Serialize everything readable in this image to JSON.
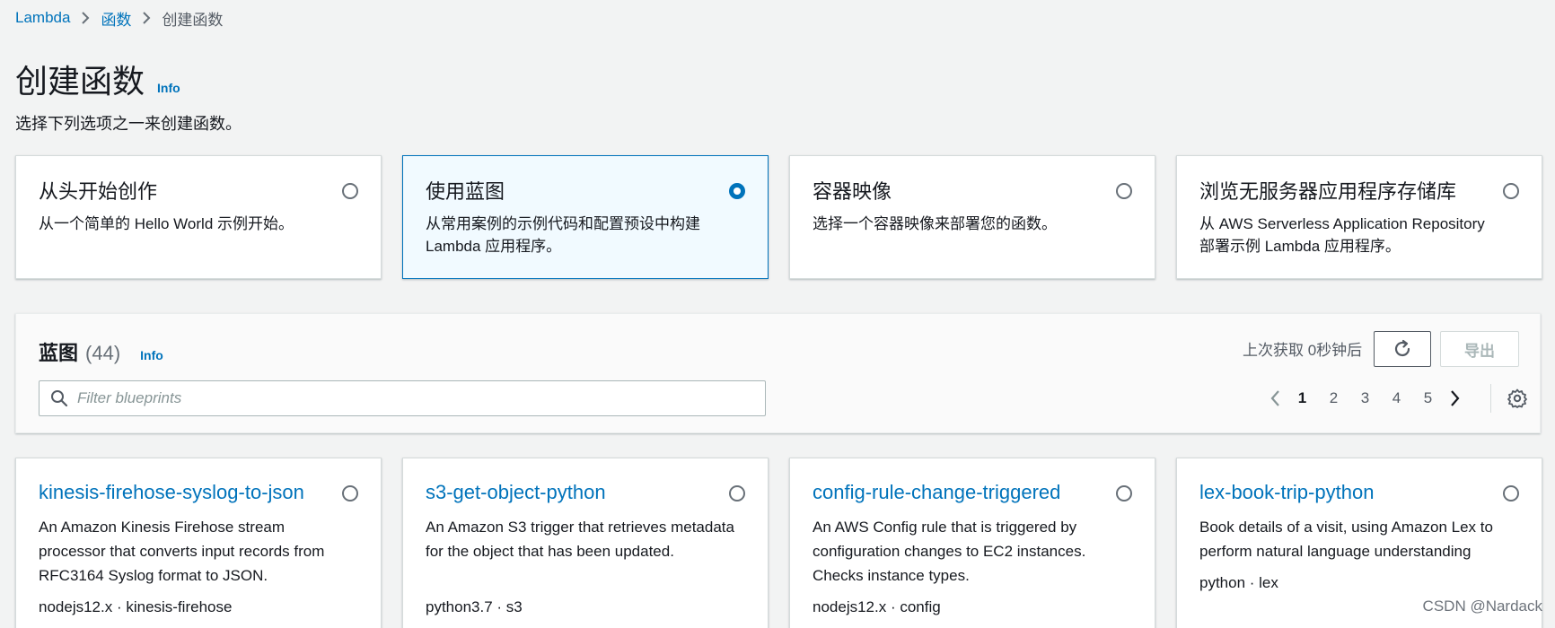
{
  "breadcrumb": {
    "items": [
      "Lambda",
      "函数"
    ],
    "current": "创建函数"
  },
  "header": {
    "title": "创建函数",
    "info": "Info",
    "subtitle": "选择下列选项之一来创建函数。"
  },
  "options": [
    {
      "title": "从头开始创作",
      "description": "从一个简单的 Hello World 示例开始。",
      "selected": false
    },
    {
      "title": "使用蓝图",
      "description": "从常用案例的示例代码和配置预设中构建 Lambda 应用程序。",
      "selected": true
    },
    {
      "title": "容器映像",
      "description": "选择一个容器映像来部署您的函数。",
      "selected": false
    },
    {
      "title": "浏览无服务器应用程序存储库",
      "description": "从 AWS Serverless Application Repository 部署示例 Lambda 应用程序。",
      "selected": false
    }
  ],
  "blueprints": {
    "heading": "蓝图",
    "count": "(44)",
    "info": "Info",
    "search_placeholder": "Filter blueprints",
    "last_fetched": "上次获取 0秒钟后",
    "export_label": "导出",
    "pages": [
      "1",
      "2",
      "3",
      "4",
      "5"
    ],
    "current_page": "1",
    "cards": [
      {
        "title": "kinesis-firehose-syslog-to-json",
        "description": "An Amazon Kinesis Firehose stream processor that converts input records from RFC3164 Syslog format to JSON.",
        "tags": "nodejs12.x · kinesis-firehose"
      },
      {
        "title": "s3-get-object-python",
        "description": "An Amazon S3 trigger that retrieves metadata for the object that has been updated.",
        "tags": "python3.7 · s3"
      },
      {
        "title": "config-rule-change-triggered",
        "description": "An AWS Config rule that is triggered by configuration changes to EC2 instances. Checks instance types.",
        "tags": "nodejs12.x · config"
      },
      {
        "title": "lex-book-trip-python",
        "description": "Book details of a visit, using Amazon Lex to perform natural language understanding",
        "tags": "python · lex"
      }
    ]
  },
  "watermark": "CSDN @Nardack",
  "colors": {
    "link": "#0073bb",
    "selected_background": "#f1faff",
    "page_background": "#f2f3f3"
  }
}
